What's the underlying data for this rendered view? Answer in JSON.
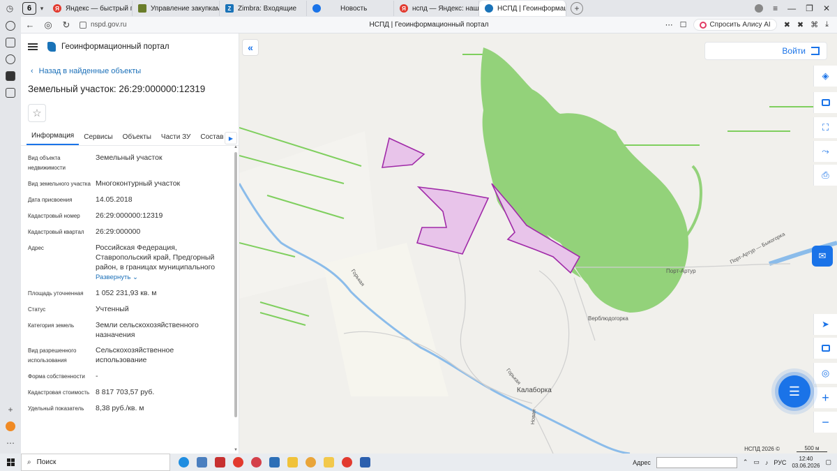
{
  "browser": {
    "tab_count": "6",
    "tabs": [
      {
        "label": "Яндекс — быстрый поиск",
        "color": "#e23a2f",
        "icon": "yandex-icon"
      },
      {
        "label": "Управление закупками",
        "color": "#6a7d2a",
        "icon": "procurement-icon"
      },
      {
        "label": "Zimbra: Входящие",
        "color": "#1a73b8",
        "icon": "zimbra-icon"
      },
      {
        "label": "Новость",
        "color": "#1a73e8",
        "icon": "news-icon"
      },
      {
        "label": "нспд — Яндекс: нашлось",
        "color": "#e23a2f",
        "icon": "yandex-icon"
      },
      {
        "label": "НСПД | Геоинформация",
        "color": "#1a73b8",
        "icon": "nspd-icon",
        "active": true
      }
    ],
    "url": "nspd.gov.ru",
    "page_title": "НСПД | Геоинформационный портал",
    "ask_alice": "Спросить Алису AI"
  },
  "panel": {
    "portal_name": "Геоинформационный портал",
    "back_link": "Назад в найденные объекты",
    "title": "Земельный участок: 26:29:000000:12319",
    "tabs": [
      "Информация",
      "Сервисы",
      "Объекты",
      "Части ЗУ",
      "Состав"
    ],
    "properties": [
      {
        "label": "Вид объекта недвижимости",
        "value": "Земельный участок"
      },
      {
        "label": "Вид земельного участка",
        "value": "Многоконтурный участок"
      },
      {
        "label": "Дата присвоения",
        "value": "14.05.2018"
      },
      {
        "label": "Кадастровый номер",
        "value": "26:29:000000:12319"
      },
      {
        "label": "Кадастровый квартал",
        "value": "26:29:000000"
      },
      {
        "label": "Адрес",
        "value": "Российская Федерация, Ставропольский край, Предгорный район, в границах муниципального",
        "expand": "Развернуть"
      },
      {
        "label": "Площадь уточненная",
        "value": "1 052 231,93 кв. м"
      },
      {
        "label": "Статус",
        "value": "Учтенный"
      },
      {
        "label": "Категория земель",
        "value": "Земли сельскохозяйственного назначения"
      },
      {
        "label": "Вид разрешенного использования",
        "value": "Сельскохозяйственное использование"
      },
      {
        "label": "Форма собственности",
        "value": "-"
      },
      {
        "label": "Кадастровая стоимость",
        "value": "8 817 703,57 руб."
      },
      {
        "label": "Удельный показатель",
        "value": "8,38 руб./кв. м"
      }
    ]
  },
  "map": {
    "login_label": "Войти",
    "places": {
      "port_artur": "Порт-Артур",
      "road_port_artur": "Порт-Артур — Быкогорка",
      "verblyudogorka": "Верблюдогорка",
      "kalaborka": "Калаборка",
      "gorkaya": "Горькая",
      "gorkaya2": "Горькая",
      "novaya": "Новая"
    },
    "attribution": "НСПД 2026 ©",
    "scale": "500 м",
    "colors": {
      "forest": "#93d27a",
      "parcel_fill": "#e8c4ea",
      "parcel_stroke": "#a02aa8",
      "river": "#8bbcea",
      "field_lines": "#7fcf5e"
    }
  },
  "taskbar": {
    "search_label": "Поиск",
    "addr_label": "Адрес",
    "lang": "РУС",
    "time": "12:40",
    "date": "03.06.2026"
  }
}
